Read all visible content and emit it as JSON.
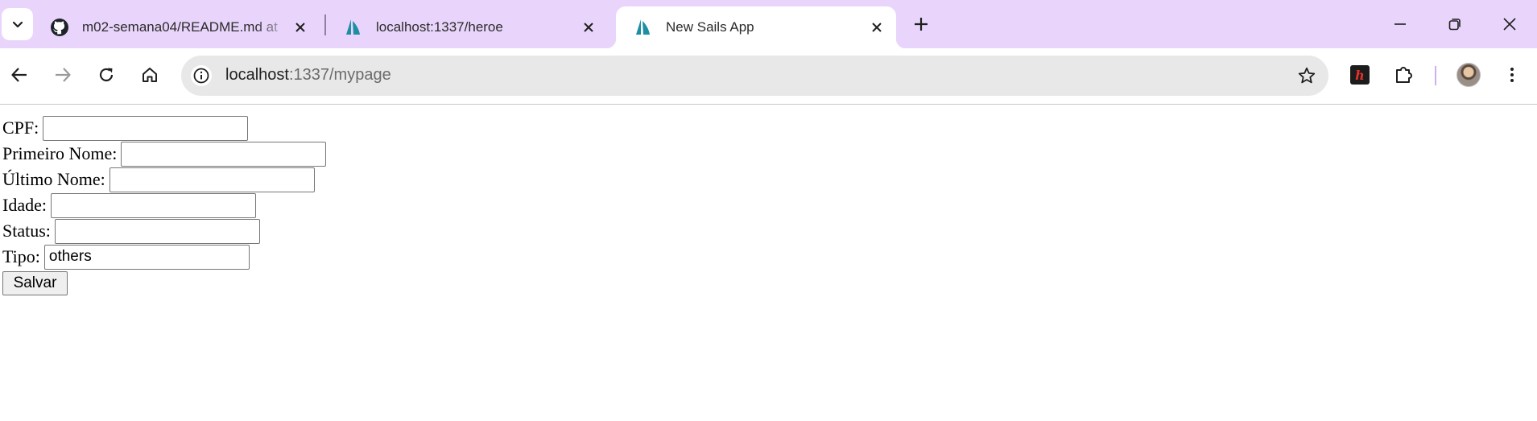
{
  "browser": {
    "tabs": [
      {
        "title": "m02-semana04/README.md at ",
        "favicon": "github-icon",
        "active": false
      },
      {
        "title": "localhost:1337/heroe",
        "favicon": "sails-icon",
        "active": false
      },
      {
        "title": "New Sails App",
        "favicon": "sails-icon",
        "active": true
      }
    ],
    "address": {
      "host": "localhost",
      "path": ":1337/mypage"
    },
    "extension_badge": "h"
  },
  "form": {
    "fields": [
      {
        "label": "CPF:",
        "value": ""
      },
      {
        "label": "Primeiro Nome:",
        "value": ""
      },
      {
        "label": "Último Nome:",
        "value": ""
      },
      {
        "label": "Idade:",
        "value": ""
      },
      {
        "label": "Status:",
        "value": ""
      },
      {
        "label": "Tipo:",
        "value": "others"
      }
    ],
    "submit_label": "Salvar"
  },
  "colors": {
    "tabstrip": "#e9d5fb",
    "sails_teal": "#1e8fa3"
  }
}
